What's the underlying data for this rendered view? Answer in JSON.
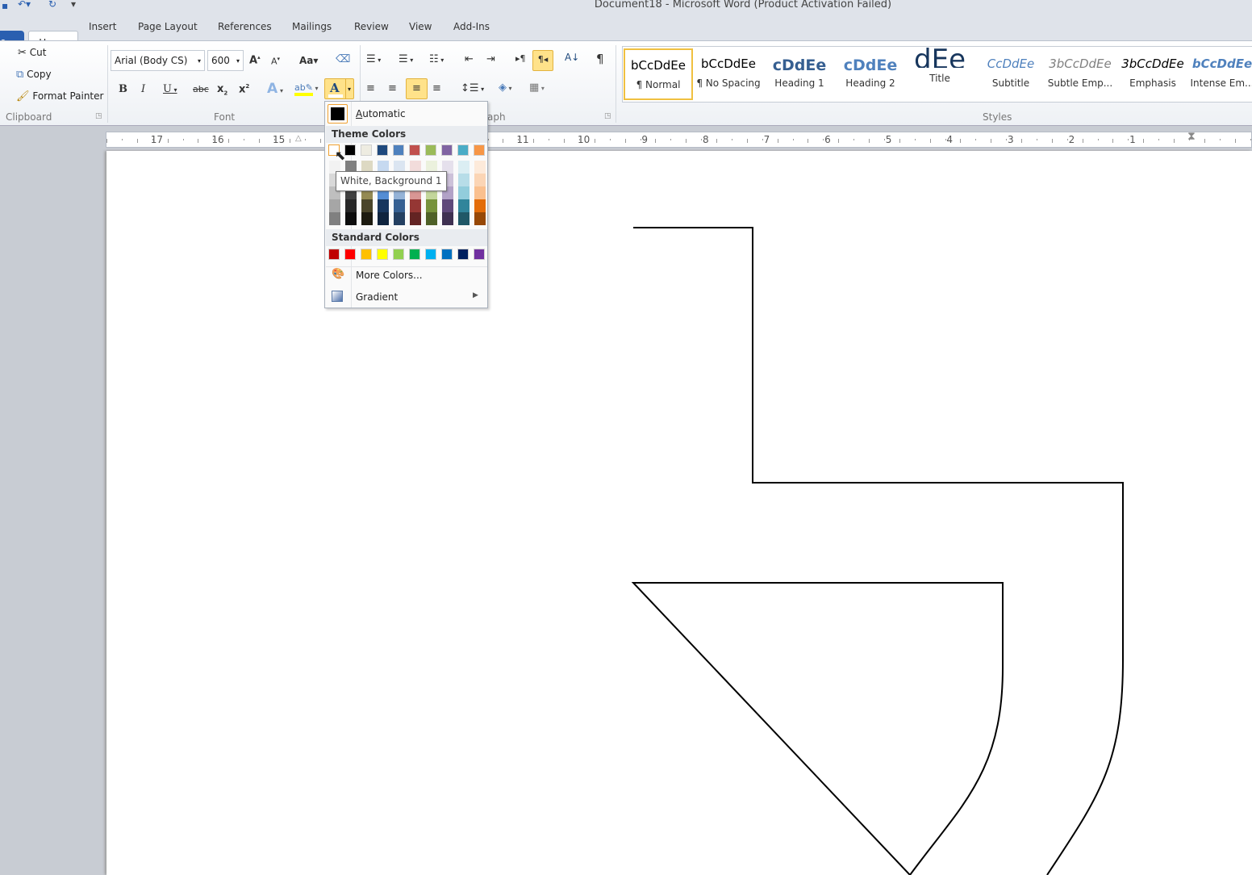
{
  "window": {
    "title": "Document18  -  Microsoft Word (Product Activation Failed)"
  },
  "tabs": [
    {
      "label": "e"
    },
    {
      "label": "Home"
    },
    {
      "label": "Insert"
    },
    {
      "label": "Page Layout"
    },
    {
      "label": "References"
    },
    {
      "label": "Mailings"
    },
    {
      "label": "Review"
    },
    {
      "label": "View"
    },
    {
      "label": "Add-Ins"
    }
  ],
  "clipboard": {
    "cut": "Cut",
    "copy": "Copy",
    "format_painter": "Format Painter",
    "group": "Clipboard"
  },
  "font": {
    "name": "Arial (Body CS)",
    "size": "600",
    "group": "Font"
  },
  "paragraph": {
    "group": "aph"
  },
  "styles": {
    "group": "Styles",
    "items": [
      {
        "preview": "bCcDdEe",
        "name": "¶ Normal",
        "color": "#000000"
      },
      {
        "preview": "bCcDdEe",
        "name": "¶ No Spacing",
        "color": "#000000"
      },
      {
        "preview": "cDdEe",
        "name": "Heading 1",
        "color": "#365f91"
      },
      {
        "preview": "cDdEe",
        "name": "Heading 2",
        "color": "#4f81bd"
      },
      {
        "preview": "dEe",
        "name": "Title",
        "color": "#17365d"
      },
      {
        "preview": "CcDdEe",
        "name": "Subtitle",
        "color": "#4f81bd"
      },
      {
        "preview": "3bCcDdEe",
        "name": "Subtle Emp...",
        "color": "#808080"
      },
      {
        "preview": "3bCcDdEe",
        "name": "Emphasis",
        "color": "#000000"
      },
      {
        "preview": "bCcDdEe",
        "name": "Intense Em...",
        "color": "#4f81bd"
      }
    ]
  },
  "ruler": {
    "numbers": [
      17,
      16,
      15,
      11,
      10,
      9,
      8,
      7,
      6,
      5,
      4,
      3,
      2,
      1
    ]
  },
  "color_menu": {
    "automatic": "Automatic",
    "theme_header": "Theme Colors",
    "standard_header": "Standard Colors",
    "more_colors": "More Colors...",
    "gradient": "Gradient",
    "tooltip": "White, Background 1",
    "theme": [
      {
        "base": "#FFFFFF",
        "shades": [
          "#F2F2F2",
          "#D9D9D9",
          "#BFBFBF",
          "#A6A6A6",
          "#808080"
        ]
      },
      {
        "base": "#000000",
        "shades": [
          "#7F7F7F",
          "#595959",
          "#404040",
          "#262626",
          "#0D0D0D"
        ]
      },
      {
        "base": "#EEECE1",
        "shades": [
          "#DDD9C3",
          "#C4BD97",
          "#948A54",
          "#4A452A",
          "#1D1B10"
        ]
      },
      {
        "base": "#1F497D",
        "shades": [
          "#C6D9F0",
          "#8DB3E2",
          "#548DD4",
          "#17365D",
          "#0F243E"
        ]
      },
      {
        "base": "#4F81BD",
        "shades": [
          "#DBE5F1",
          "#B8CCE4",
          "#95B3D7",
          "#366092",
          "#244061"
        ]
      },
      {
        "base": "#C0504D",
        "shades": [
          "#F2DCDB",
          "#E5B9B7",
          "#D99694",
          "#953734",
          "#632423"
        ]
      },
      {
        "base": "#9BBB59",
        "shades": [
          "#EBF1DD",
          "#D7E3BC",
          "#C3D69B",
          "#76923C",
          "#4F6128"
        ]
      },
      {
        "base": "#8064A2",
        "shades": [
          "#E5E0EC",
          "#CCC1D9",
          "#B2A2C7",
          "#5F497A",
          "#3F3151"
        ]
      },
      {
        "base": "#4BACC6",
        "shades": [
          "#DBEEF3",
          "#B7DDE8",
          "#92CDDC",
          "#31859B",
          "#205867"
        ]
      },
      {
        "base": "#F79646",
        "shades": [
          "#FDEADA",
          "#FBD5B5",
          "#FAC08F",
          "#E36C09",
          "#974806"
        ]
      }
    ],
    "standard": [
      "#C00000",
      "#FF0000",
      "#FFC000",
      "#FFFF00",
      "#92D050",
      "#00B050",
      "#00B0F0",
      "#0070C0",
      "#002060",
      "#7030A0"
    ]
  }
}
